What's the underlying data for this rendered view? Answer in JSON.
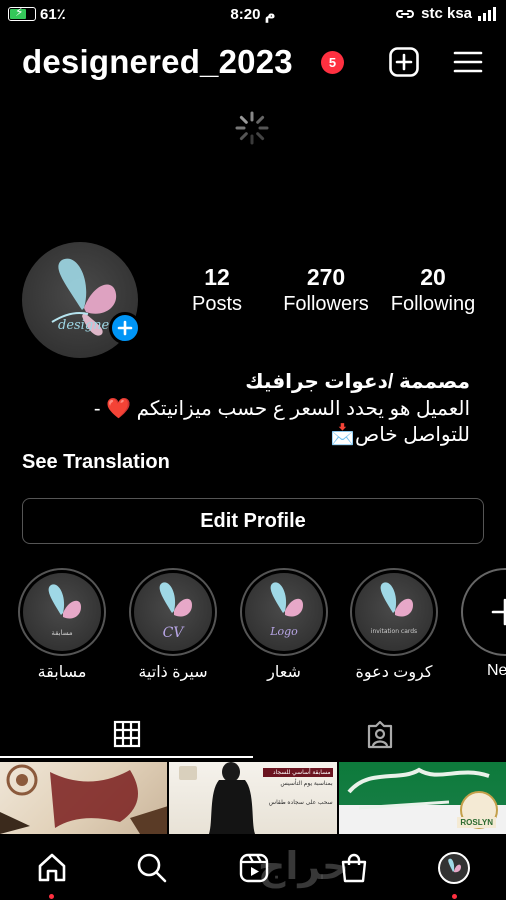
{
  "status_bar": {
    "battery": "61٪",
    "time": "8:20 م",
    "carrier": "stc ksa"
  },
  "header": {
    "username": "designered_2023",
    "notification_count": "5",
    "icons": [
      "plus-square-icon",
      "hamburger-menu-icon"
    ]
  },
  "profile": {
    "avatar_text": "designer",
    "stats": [
      {
        "value": "12",
        "label": "Posts"
      },
      {
        "value": "270",
        "label": "Followers"
      },
      {
        "value": "20",
        "label": "Following"
      }
    ],
    "bio_name": "مصممة /دعوات جرافيك",
    "bio_line1": "العميل هو يحدد السعر ع حسب ميزانيتكم ❤️ -",
    "bio_line2": "للتواصل خاص📩",
    "see_translation": "See Translation",
    "edit_profile": "Edit Profile"
  },
  "highlights": [
    {
      "label": "مسابقة",
      "caption": "مسابقة"
    },
    {
      "label": "سيرة ذاتية",
      "caption": "CV"
    },
    {
      "label": "شعار",
      "caption": "Logo"
    },
    {
      "label": "كروت دعوة",
      "caption": "invitation cards"
    },
    {
      "label": "New"
    }
  ],
  "tabs": [
    "grid-icon",
    "tagged-person-icon"
  ],
  "posts": [
    {
      "caption": ""
    },
    {
      "title": "مسابقة أساسي للسجاد",
      "line2": "بمناسبة يوم التأسيس",
      "line3": "سحب على سجاده طقاس"
    },
    {
      "text": "ROSLYN"
    }
  ],
  "bottom_nav": [
    "home-icon",
    "search-icon",
    "reels-icon",
    "shop-icon",
    "profile-avatar"
  ],
  "watermark": "حراج",
  "colors": {
    "accent_blue": "#0095f6",
    "badge_red": "#ff3040",
    "battery_green": "#34c759"
  }
}
